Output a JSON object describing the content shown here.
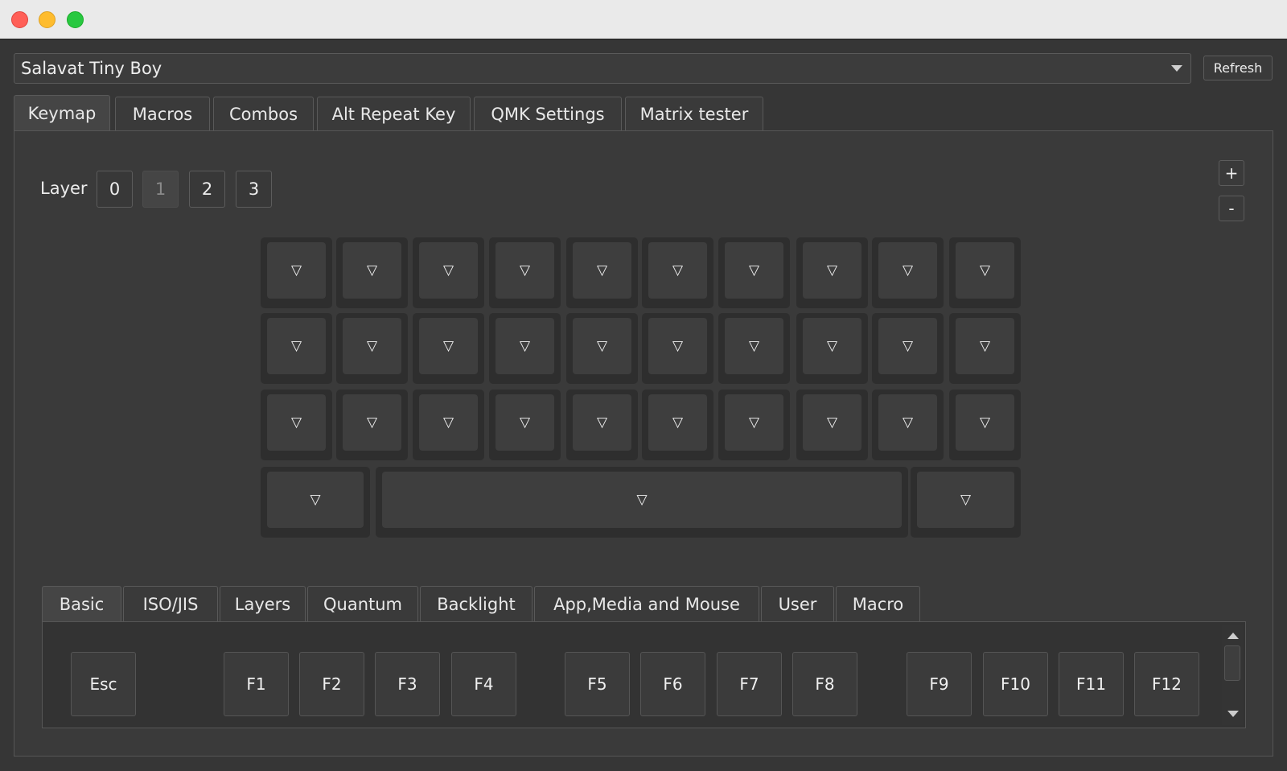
{
  "device": {
    "name": "Salavat Tiny Boy",
    "refresh_label": "Refresh"
  },
  "main_tabs": [
    {
      "label": "Keymap",
      "active": true
    },
    {
      "label": "Macros"
    },
    {
      "label": "Combos"
    },
    {
      "label": "Alt Repeat Key"
    },
    {
      "label": "QMK Settings"
    },
    {
      "label": "Matrix tester"
    }
  ],
  "layers": {
    "label": "Layer",
    "buttons": [
      "0",
      "1",
      "2",
      "3"
    ],
    "selected": "1"
  },
  "zoom": {
    "in_label": "+",
    "out_label": "-"
  },
  "key_glyph": "▽",
  "code_tabs": [
    {
      "label": "Basic",
      "active": true
    },
    {
      "label": "ISO/JIS"
    },
    {
      "label": "Layers"
    },
    {
      "label": "Quantum"
    },
    {
      "label": "Backlight"
    },
    {
      "label": "App,Media and Mouse"
    },
    {
      "label": "User"
    },
    {
      "label": "Macro"
    }
  ],
  "keycodes": [
    "Esc",
    "F1",
    "F2",
    "F3",
    "F4",
    "F5",
    "F6",
    "F7",
    "F8",
    "F9",
    "F10",
    "F11",
    "F12"
  ]
}
